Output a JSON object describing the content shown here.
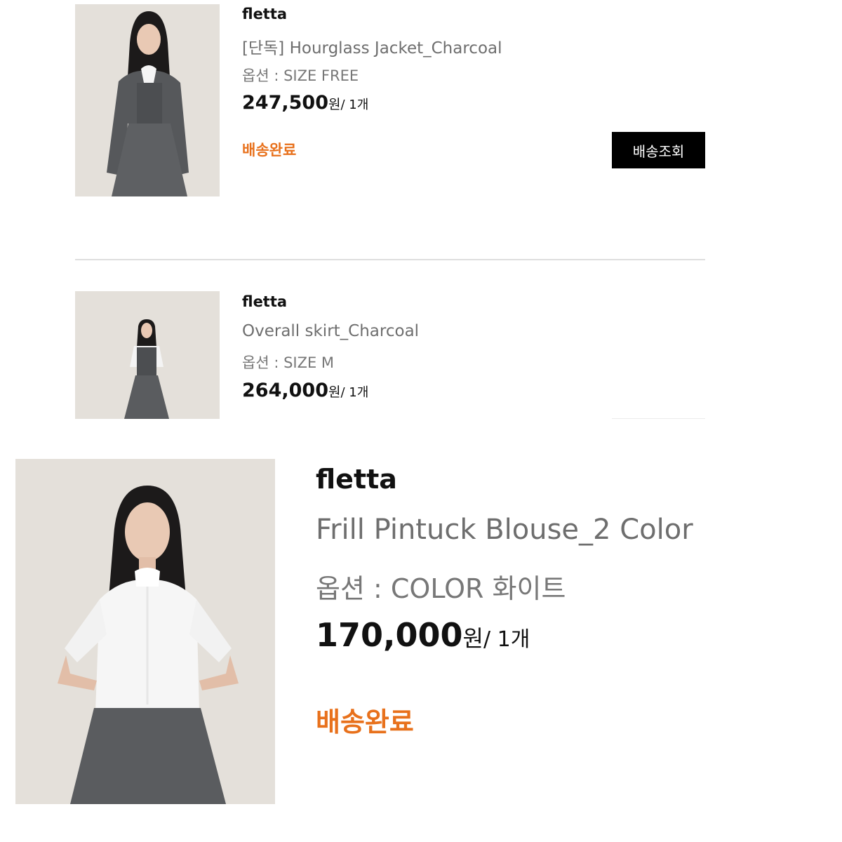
{
  "orders": [
    {
      "brand": "fletta",
      "product_name": "[단독] Hourglass Jacket_Charcoal",
      "option": "옵션 : SIZE FREE",
      "price": "247,500",
      "price_unit": "원",
      "quantity": "/ 1개",
      "status": "배송완료",
      "track_button": "배송조회",
      "thumb_icon": "product-photo-jacket"
    },
    {
      "brand": "fletta",
      "product_name": "Overall skirt_Charcoal",
      "option": "옵션 : SIZE M",
      "price": "264,000",
      "price_unit": "원",
      "quantity": "/ 1개",
      "thumb_icon": "product-photo-skirt"
    },
    {
      "brand": "fletta",
      "product_name": "Frill Pintuck Blouse_2 Color",
      "option": "옵션 : COLOR 화이트",
      "price": "170,000",
      "price_unit": "원",
      "quantity": "/ 1개",
      "status": "배송완료",
      "thumb_icon": "product-photo-blouse"
    }
  ],
  "colors": {
    "status_orange": "#e8711c",
    "button_black": "#000000",
    "photo_background": "#e4e0da",
    "charcoal_garment": "#5a5c5f"
  }
}
